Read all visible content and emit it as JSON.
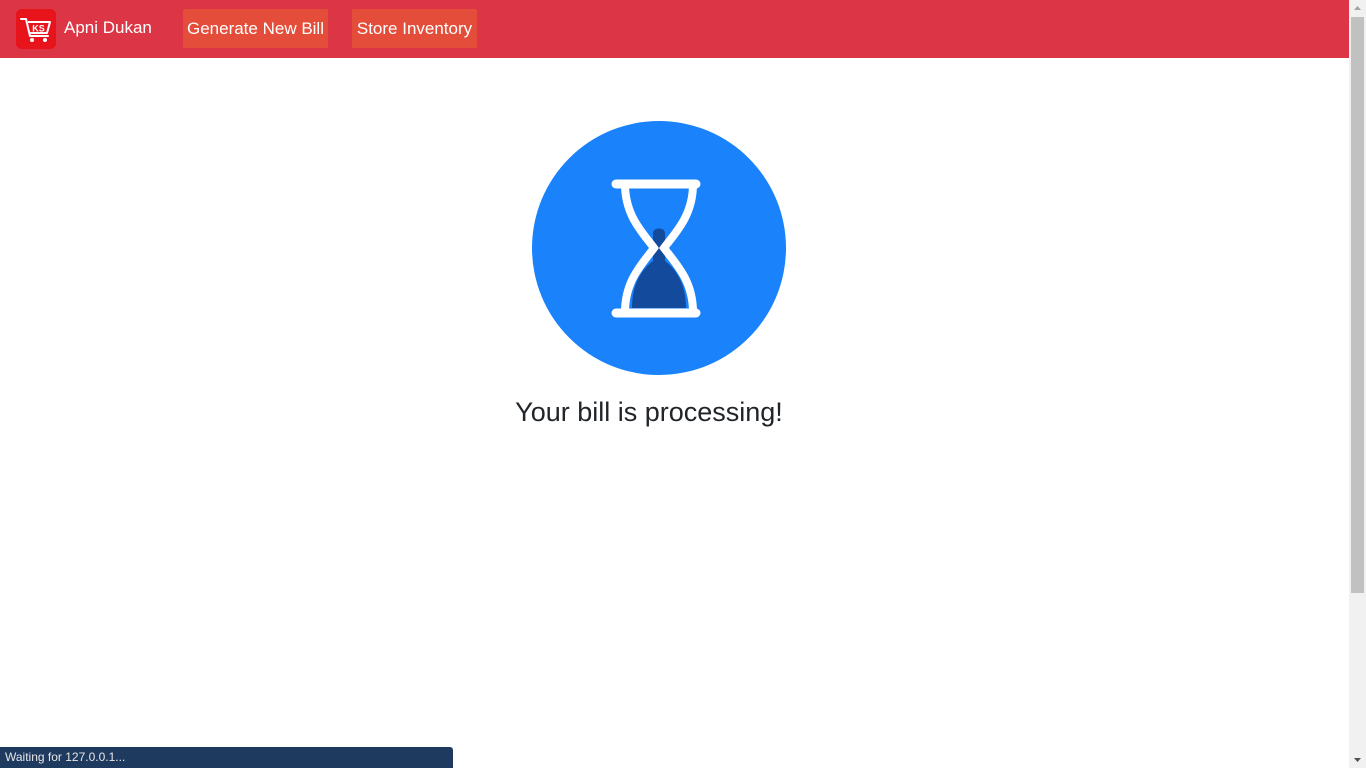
{
  "navbar": {
    "brand_name": "Apni Dukan",
    "logo_text": "KS",
    "logo_icon": "shopping-cart-icon",
    "generate_bill_label": "Generate New Bill",
    "store_inventory_label": "Store Inventory",
    "background_color": "#dc3545",
    "button_color": "#e44d3a"
  },
  "main": {
    "status_icon": "hourglass-icon",
    "icon_circle_color": "#1a82fb",
    "message": "Your bill is processing!"
  },
  "browser": {
    "status_text": "Waiting for 127.0.0.1..."
  }
}
